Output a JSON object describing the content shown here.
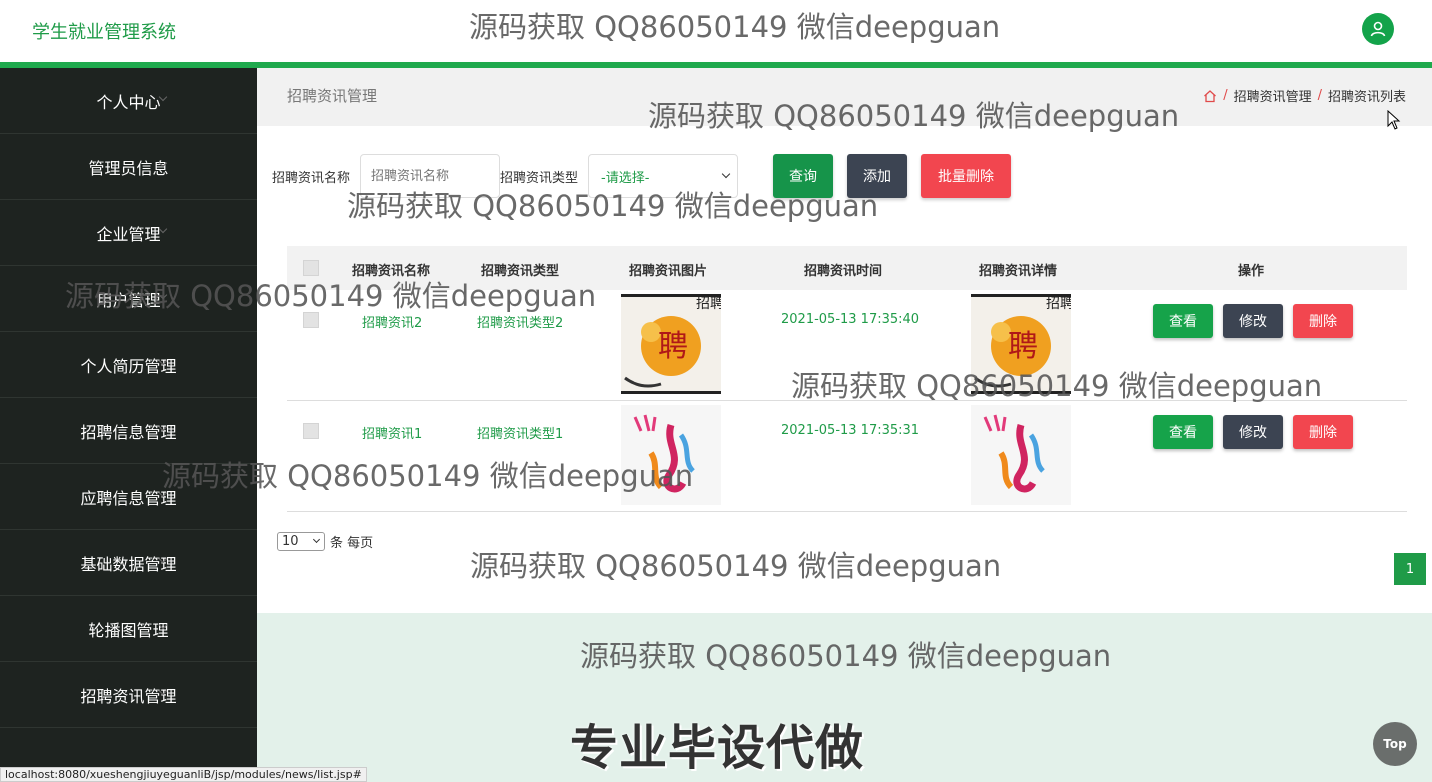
{
  "header": {
    "brand": "学生就业管理系统"
  },
  "sidebar": {
    "items": [
      {
        "label": "个人中心"
      },
      {
        "label": "管理员信息"
      },
      {
        "label": "企业管理"
      },
      {
        "label": "用户管理"
      },
      {
        "label": "个人简历管理"
      },
      {
        "label": "招聘信息管理"
      },
      {
        "label": "应聘信息管理"
      },
      {
        "label": "基础数据管理"
      },
      {
        "label": "轮播图管理"
      },
      {
        "label": "招聘资讯管理"
      }
    ]
  },
  "page": {
    "title": "招聘资讯管理",
    "breadcrumb": [
      "招聘资讯管理",
      "招聘资讯列表"
    ],
    "separator": "/"
  },
  "search": {
    "name_label": "招聘资讯名称",
    "name_placeholder": "招聘资讯名称",
    "type_label": "招聘资讯类型",
    "type_selected": "-请选择-",
    "query_button": "查询",
    "add_button": "添加",
    "batch_delete_button": "批量删除"
  },
  "table": {
    "columns": [
      "招聘资讯名称",
      "招聘资讯类型",
      "招聘资讯图片",
      "招聘资讯时间",
      "招聘资讯详情",
      "操作"
    ],
    "rows": [
      {
        "name": "招聘资讯2",
        "type": "招聘资讯类型2",
        "time": "2021-05-13 17:35:40"
      },
      {
        "name": "招聘资讯1",
        "type": "招聘资讯类型1",
        "time": "2021-05-13 17:35:31"
      }
    ],
    "actions": {
      "view": "查看",
      "edit": "修改",
      "delete": "删除"
    }
  },
  "pagination": {
    "page_size": "10",
    "per_page_text": "条 每页",
    "current_page": "1"
  },
  "watermark": "源码获取 QQ86050149 微信deepguan",
  "promo": "专业毕设代做",
  "top_button": "Top",
  "status_url": "localhost:8080/xueshengjiuyeguanliB/jsp/modules/news/list.jsp#",
  "colors": {
    "primary_green": "#1f9b48",
    "sidebar_bg": "#1e2320",
    "edit_btn": "#3c4452",
    "delete_btn": "#f2464f"
  }
}
